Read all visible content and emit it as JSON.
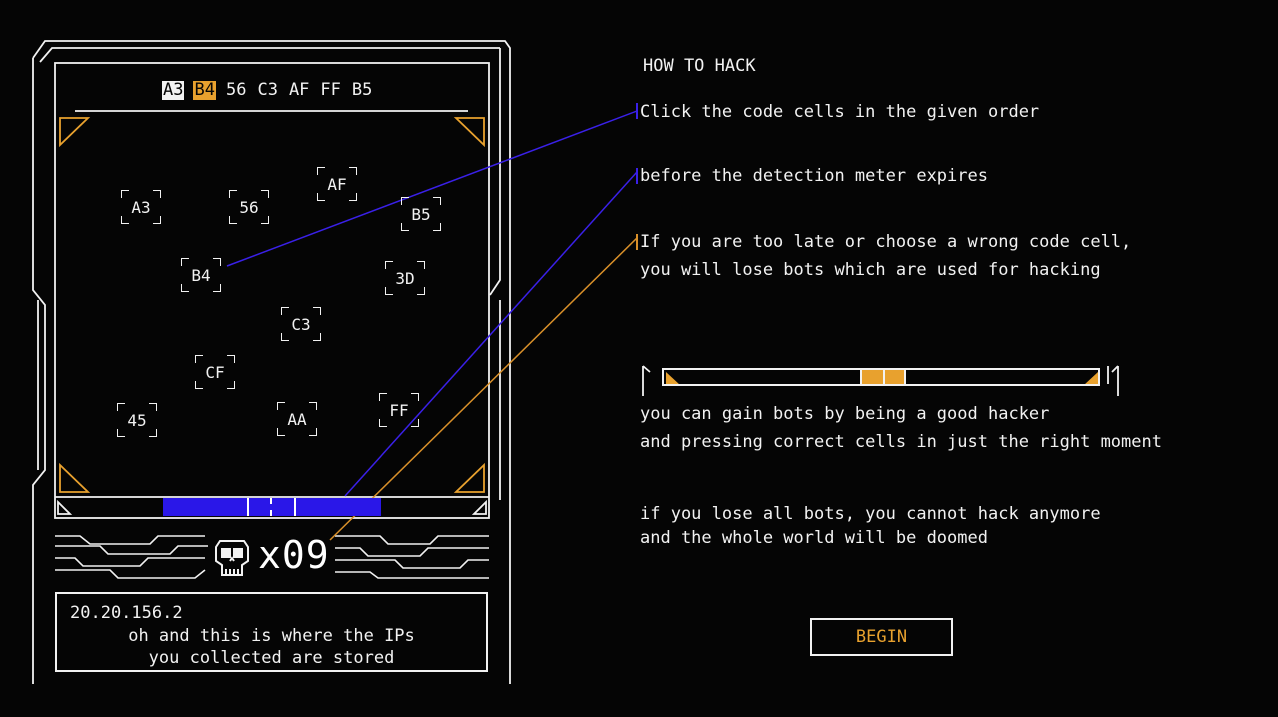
{
  "sequence": [
    {
      "code": "A3",
      "state": "done"
    },
    {
      "code": "B4",
      "state": "active"
    },
    {
      "code": "56",
      "state": "pending"
    },
    {
      "code": "C3",
      "state": "pending"
    },
    {
      "code": "AF",
      "state": "pending"
    },
    {
      "code": "FF",
      "state": "pending"
    },
    {
      "code": "B5",
      "state": "pending"
    }
  ],
  "cells": [
    "A3",
    "56",
    "AF",
    "B5",
    "B4",
    "3D",
    "C3",
    "CF",
    "45",
    "AA",
    "FF"
  ],
  "detection_meter_fraction": 0.5,
  "bots": {
    "count": "x09"
  },
  "ip_panel": {
    "ip": "20.20.156.2",
    "message_line1": "oh and this is where the IPs",
    "message_line2": "you collected are stored"
  },
  "tutorial": {
    "title": "HOW TO HACK",
    "step1": "Click the code cells in the given order",
    "step2": "before the detection meter expires",
    "step3_line1": "If you are too late or choose a wrong code cell,",
    "step3_line2": "you will lose bots which are used for hacking",
    "gain_line1": "you can gain bots by being a good hacker",
    "gain_line2": "and pressing correct cells in just the right moment",
    "lose_line1": "if you lose all bots, you cannot hack anymore",
    "lose_line2": "and the whole world will be doomed"
  },
  "begin_button": "BEGIN",
  "colors": {
    "accent": "#e8a12e",
    "meter": "#2a17e8",
    "pointer_orange": "#d9902a",
    "pointer_blue": "#3a20e8"
  }
}
